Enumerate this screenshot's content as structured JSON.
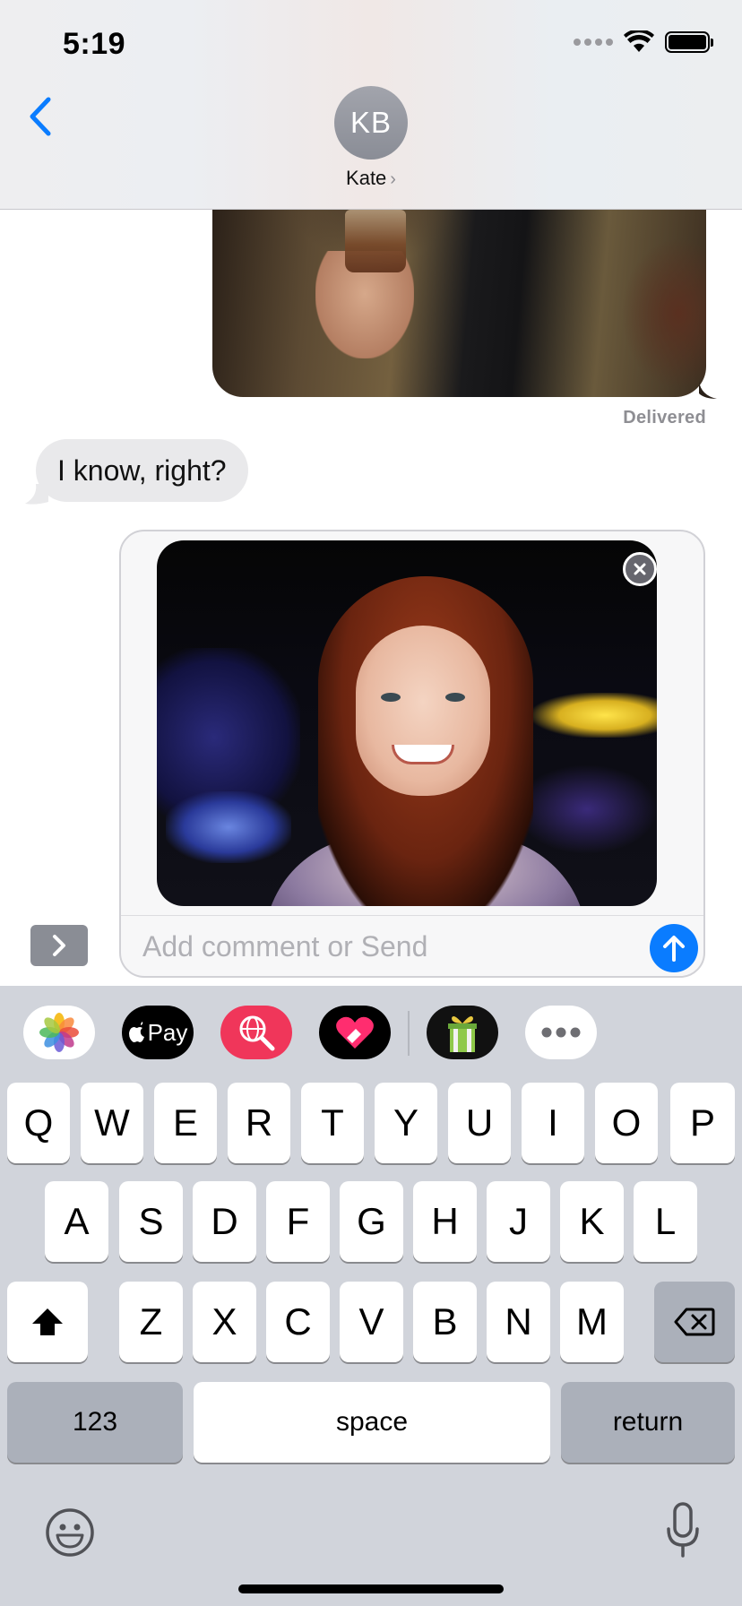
{
  "status_bar": {
    "time": "5:19"
  },
  "header": {
    "avatar_initials": "KB",
    "contact_name": "Kate",
    "contact_chevron": "›"
  },
  "conversation": {
    "delivered_label": "Delivered",
    "incoming_message": "I know, right?"
  },
  "compose": {
    "placeholder": "Add comment or Send",
    "value": ""
  },
  "app_strip": [
    {
      "name": "photos-icon"
    },
    {
      "name": "apple-pay-icon",
      "label": "Pay"
    },
    {
      "name": "web-search-icon"
    },
    {
      "name": "digital-touch-icon"
    },
    {
      "name": "gift-icon"
    },
    {
      "name": "more-apps-icon"
    }
  ],
  "keyboard": {
    "row1": [
      "Q",
      "W",
      "E",
      "R",
      "T",
      "Y",
      "U",
      "I",
      "O",
      "P"
    ],
    "row2": [
      "A",
      "S",
      "D",
      "F",
      "G",
      "H",
      "J",
      "K",
      "L"
    ],
    "row3": [
      "Z",
      "X",
      "C",
      "V",
      "B",
      "N",
      "M"
    ],
    "numbers_label": "123",
    "space_label": "space",
    "return_label": "return"
  },
  "colors": {
    "accent_blue": "#0a7cff",
    "incoming_bubble": "#e9e9eb",
    "keyboard_bg": "#d1d4db",
    "apple_pay_bg": "#000000",
    "search_app_bg": "#f0365a"
  }
}
